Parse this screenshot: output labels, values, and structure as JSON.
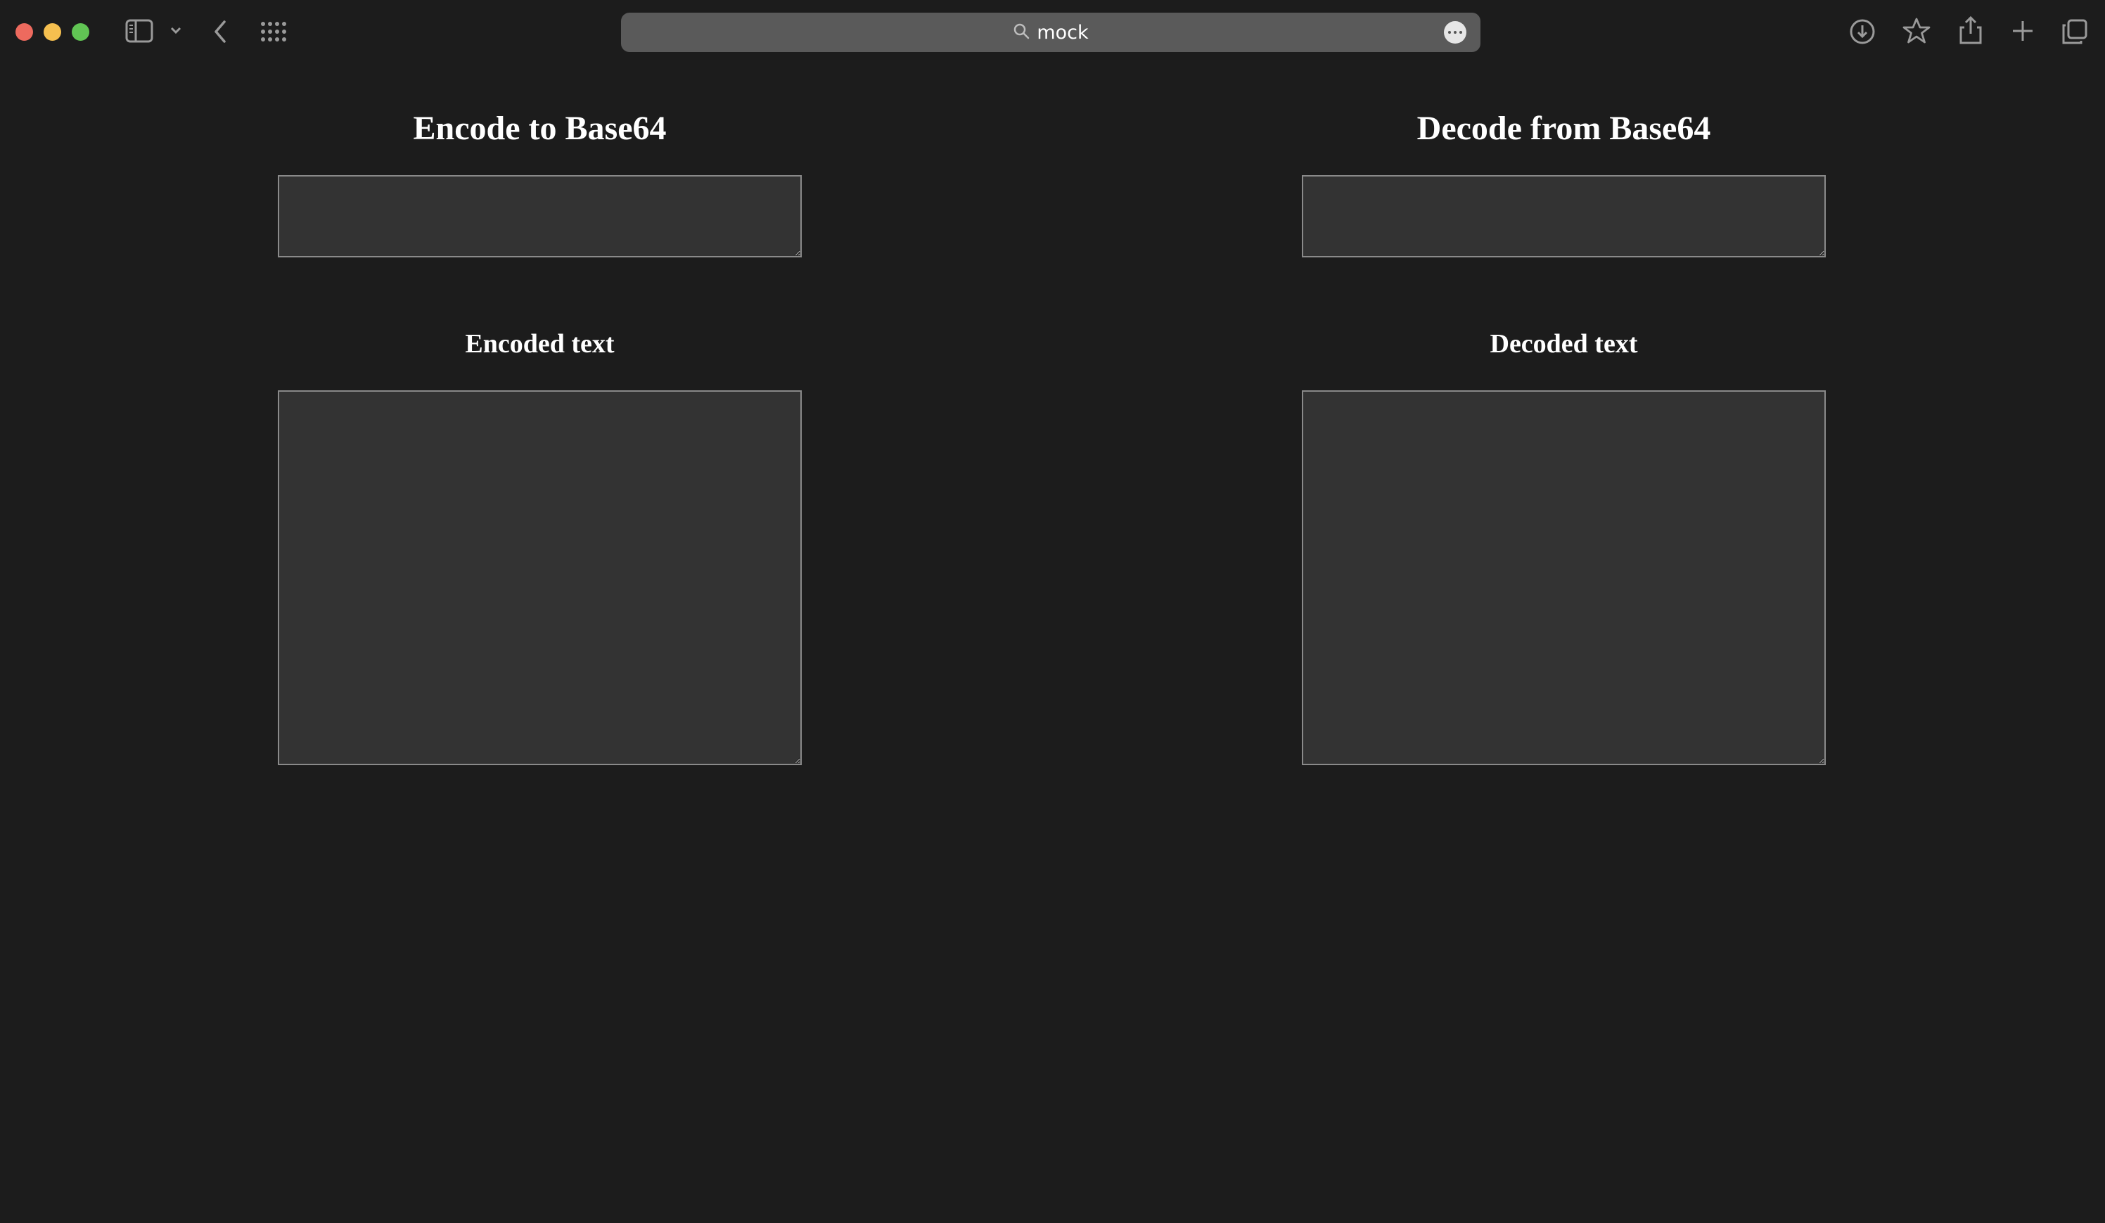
{
  "browser": {
    "address": "mock",
    "icons": {
      "sidebar": "sidebar-icon",
      "sidebar_menu": "chevron-down-icon",
      "back": "chevron-left-icon",
      "tab_overview": "grid-icon",
      "search": "search-icon",
      "page_menu": "ellipsis-icon",
      "downloads": "download-icon",
      "bookmark": "star-icon",
      "share": "share-icon",
      "new_tab": "plus-icon",
      "tabs": "tabs-icon"
    }
  },
  "encode": {
    "title": "Encode to Base64",
    "input_value": "",
    "output_label": "Encoded text",
    "output_value": ""
  },
  "decode": {
    "title": "Decode from Base64",
    "input_value": "",
    "output_label": "Decoded text",
    "output_value": ""
  },
  "colors": {
    "background": "#1c1c1c",
    "textarea_bg": "#333333",
    "textarea_border": "#8a8a8a",
    "address_bar": "#5a5a5a",
    "close": "#ed6a5e",
    "minimize": "#f5bf4f",
    "maximize": "#61c554"
  }
}
